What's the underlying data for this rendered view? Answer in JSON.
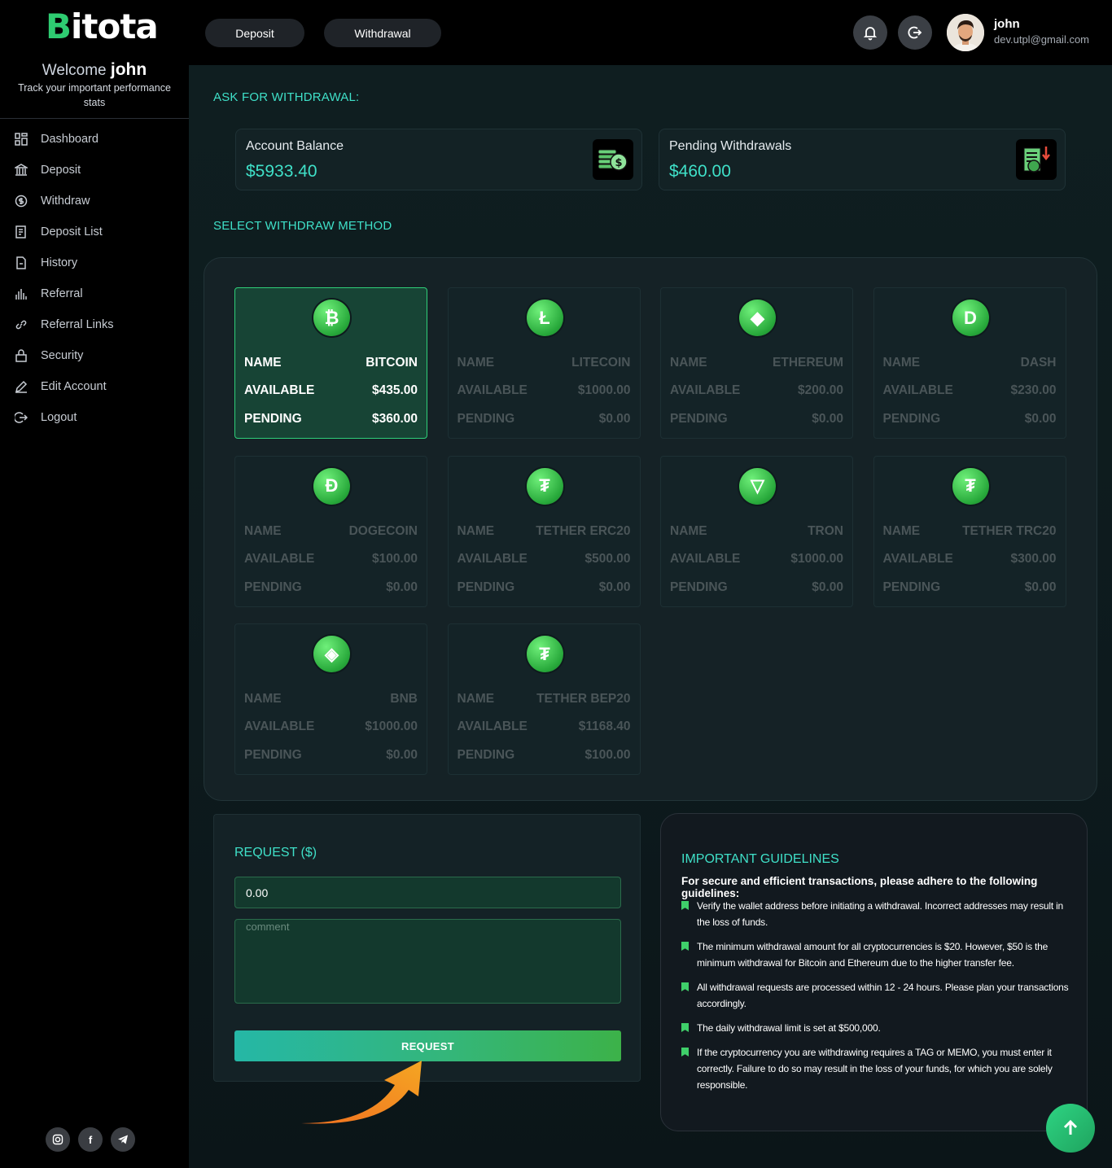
{
  "sidebar": {
    "logo_text": "itota",
    "logo_letter": "B",
    "welcome_prefix": "Welcome",
    "welcome_name": "john",
    "tagline": "Track your important performance stats",
    "items": [
      {
        "label": "Dashboard",
        "icon": "dashboard-icon"
      },
      {
        "label": "Deposit",
        "icon": "bank-icon"
      },
      {
        "label": "Withdraw",
        "icon": "dollar-circle-icon"
      },
      {
        "label": "Deposit List",
        "icon": "list-icon"
      },
      {
        "label": "History",
        "icon": "document-icon"
      },
      {
        "label": "Referral",
        "icon": "bar-chart-icon"
      },
      {
        "label": "Referral Links",
        "icon": "link-icon"
      },
      {
        "label": "Security",
        "icon": "lock-icon"
      },
      {
        "label": "Edit Account",
        "icon": "pencil-icon"
      },
      {
        "label": "Logout",
        "icon": "logout-icon"
      }
    ],
    "socials": [
      "instagram-icon",
      "facebook-icon",
      "telegram-icon"
    ]
  },
  "topbar": {
    "deposit_label": "Deposit",
    "withdrawal_label": "Withdrawal",
    "user_name": "john",
    "user_email": "dev.utpl@gmail.com"
  },
  "main": {
    "ask_title": "ASK FOR WITHDRAWAL:",
    "balance_label": "Account Balance",
    "balance_value": "$5933.40",
    "pending_label": "Pending Withdrawals",
    "pending_value": "$460.00",
    "method_title": "SELECT WITHDRAW METHOD",
    "row_labels": {
      "name": "NAME",
      "available": "AVAILABLE",
      "pending": "PENDING"
    },
    "methods": [
      {
        "name": "BITCOIN",
        "available": "$435.00",
        "pending": "$360.00",
        "icon": "bitcoin-icon",
        "glyph": "₿",
        "active": true
      },
      {
        "name": "LITECOIN",
        "available": "$1000.00",
        "pending": "$0.00",
        "icon": "litecoin-icon",
        "glyph": "Ł",
        "active": false
      },
      {
        "name": "ETHEREUM",
        "available": "$200.00",
        "pending": "$0.00",
        "icon": "ethereum-icon",
        "glyph": "◆",
        "active": false
      },
      {
        "name": "DASH",
        "available": "$230.00",
        "pending": "$0.00",
        "icon": "dash-icon",
        "glyph": "D",
        "active": false
      },
      {
        "name": "DOGECOIN",
        "available": "$100.00",
        "pending": "$0.00",
        "icon": "dogecoin-icon",
        "glyph": "Ð",
        "active": false
      },
      {
        "name": "TETHER ERC20",
        "available": "$500.00",
        "pending": "$0.00",
        "icon": "tether-icon",
        "glyph": "₮",
        "active": false
      },
      {
        "name": "TRON",
        "available": "$1000.00",
        "pending": "$0.00",
        "icon": "tron-icon",
        "glyph": "▽",
        "active": false
      },
      {
        "name": "TETHER TRC20",
        "available": "$300.00",
        "pending": "$0.00",
        "icon": "tether-trc20-icon",
        "glyph": "₮",
        "active": false
      },
      {
        "name": "BNB",
        "available": "$1000.00",
        "pending": "$0.00",
        "icon": "bnb-icon",
        "glyph": "◈",
        "active": false
      },
      {
        "name": "TETHER BEP20",
        "available": "$1168.40",
        "pending": "$100.00",
        "icon": "tether-bep20-icon",
        "glyph": "₮",
        "active": false
      }
    ],
    "request_title": "REQUEST ($)",
    "amount_value": "0.00",
    "comment_placeholder": "comment",
    "request_button": "REQUEST"
  },
  "guidelines": {
    "title": "IMPORTANT GUIDELINES",
    "intro": "For secure and efficient transactions, please adhere to the following guidelines:",
    "items": [
      "Verify the wallet address before initiating a withdrawal. Incorrect addresses may result in the loss of funds.",
      "The minimum withdrawal amount for all cryptocurrencies is $20. However, $50 is the minimum withdrawal for Bitcoin and Ethereum due to the higher transfer fee.",
      "All withdrawal requests are processed within 12 - 24 hours. Please plan your transactions accordingly.",
      "The daily withdrawal limit is set at $500,000.",
      "If the cryptocurrency you are withdrawing requires a TAG or MEMO, you must enter it correctly. Failure to do so may result in the loss of your funds, for which you are solely responsible."
    ]
  },
  "colors": {
    "accent": "#3fe0c8",
    "green": "#2fd07a",
    "active_card": "#174435"
  }
}
